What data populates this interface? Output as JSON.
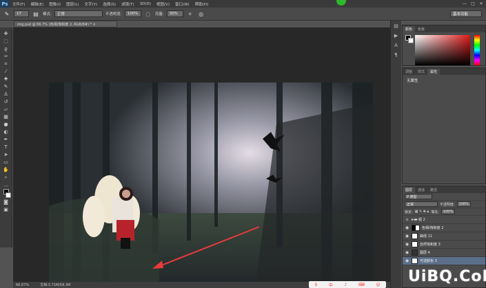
{
  "menubar": {
    "logo": "Ps",
    "items": [
      "文件(F)",
      "编辑(E)",
      "图像(I)",
      "图层(L)",
      "文字(Y)",
      "选择(S)",
      "滤镜(T)",
      "3D(D)",
      "视图(V)",
      "窗口(W)",
      "帮助(H)"
    ],
    "window_controls": [
      "—",
      "□",
      "✕"
    ]
  },
  "options": {
    "brush_size": "17",
    "mode_label": "模式:",
    "mode_value": "正常",
    "opacity_label": "不透明度:",
    "opacity_value": "100%",
    "flow_label": "流量:",
    "flow_value": "30%",
    "workspace": "基本功能"
  },
  "document": {
    "tab_label": "img.psd @ 66.7% (色相/饱和度 2, RGB/8#) *  ×",
    "zoom": "66.67%",
    "doc_size": "文档:3.71M/58.3M"
  },
  "panels": {
    "color_tabs": [
      "颜色",
      "色板"
    ],
    "props_tabs": [
      "调整",
      "样式",
      "属性"
    ],
    "props_text": "无属性",
    "layers_tabs": [
      "图层",
      "通道",
      "路径"
    ],
    "layers": {
      "filter_label": "P 类型",
      "blend_mode": "正常",
      "opacity_label": "不透明度:",
      "opacity_value": "100%",
      "lock_label": "锁定:",
      "fill_label": "填充:",
      "fill_value": "100%",
      "items": [
        {
          "name": "组 2",
          "type": "group"
        },
        {
          "name": "色相/饱和度 2",
          "type": "adjust"
        },
        {
          "name": "曲线 11",
          "type": "adjust"
        },
        {
          "name": "自然饱和度 3",
          "type": "adjust"
        },
        {
          "name": "图层 4",
          "type": "pixel"
        },
        {
          "name": "可选颜色 3",
          "type": "adjust"
        }
      ]
    }
  },
  "watermark": "UiBQ.CoM",
  "colors": {
    "menubar": "#3a3a3a",
    "canvas_bg": "#282828",
    "accent_arrow": "#e83a3a",
    "selected_layer": "#5c6f8a"
  }
}
